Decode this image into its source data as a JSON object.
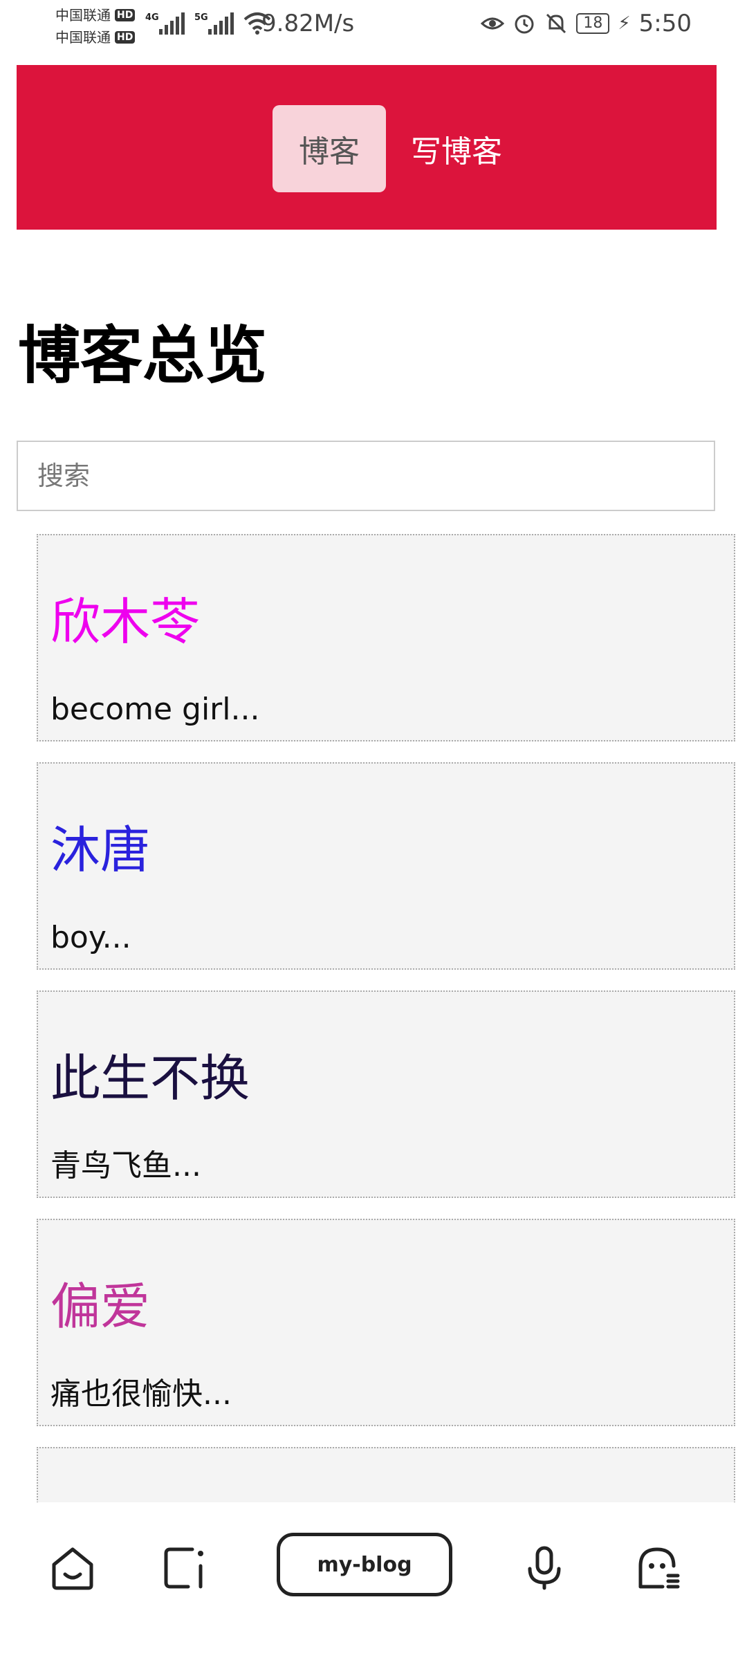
{
  "statusbar": {
    "carrier1": "中国联通",
    "carrier2": "中国联通",
    "hd": "HD",
    "net1": "4G",
    "net2": "5G",
    "speed": "9.82M/s",
    "battery": "18",
    "time": "5:50"
  },
  "header": {
    "nav": [
      {
        "label": "博客"
      },
      {
        "label": "写博客"
      }
    ]
  },
  "page": {
    "title": "博客总览"
  },
  "search": {
    "placeholder": "搜索"
  },
  "posts": [
    {
      "title": "欣木苓",
      "excerpt": "become girl...",
      "color": "#ee00ee"
    },
    {
      "title": "沐唐",
      "excerpt": "boy...",
      "color": "#2a22dd"
    },
    {
      "title": "此生不换",
      "excerpt": "青鸟飞鱼...",
      "color": "#1a1040"
    },
    {
      "title": "偏爱",
      "excerpt": "痛也很愉快...",
      "color": "#c0359a"
    },
    {
      "title": "",
      "excerpt": "",
      "color": "#000000"
    }
  ],
  "bottombar": {
    "center_label": "my-blog",
    "icons": [
      "home-icon",
      "tabs-icon",
      "microphone-icon",
      "assistant-icon"
    ]
  },
  "colors": {
    "header_bg": "#dc143c",
    "nav_active_bg": "#f8d3da",
    "card_bg": "#f4f4f4"
  }
}
